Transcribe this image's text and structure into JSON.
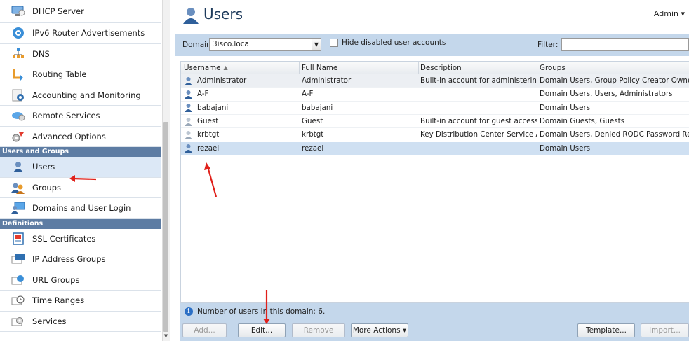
{
  "sidebar": {
    "items_top": [
      {
        "label": "DHCP Server",
        "icon": "dhcp-server-icon"
      },
      {
        "label": "IPv6 Router Advertisements",
        "icon": "ipv6-icon"
      },
      {
        "label": "DNS",
        "icon": "dns-icon"
      },
      {
        "label": "Routing Table",
        "icon": "routing-table-icon"
      },
      {
        "label": "Accounting and Monitoring",
        "icon": "accounting-icon"
      },
      {
        "label": "Remote Services",
        "icon": "remote-services-icon"
      },
      {
        "label": "Advanced Options",
        "icon": "advanced-options-icon"
      }
    ],
    "section_users": "Users and Groups",
    "items_users": [
      {
        "label": "Users",
        "icon": "users-icon"
      },
      {
        "label": "Groups",
        "icon": "groups-icon"
      },
      {
        "label": "Domains and User Login",
        "icon": "domains-icon"
      }
    ],
    "section_definitions": "Definitions",
    "items_definitions": [
      {
        "label": "SSL Certificates",
        "icon": "ssl-certificate-icon"
      },
      {
        "label": "IP Address Groups",
        "icon": "ip-address-groups-icon"
      },
      {
        "label": "URL Groups",
        "icon": "url-groups-icon"
      },
      {
        "label": "Time Ranges",
        "icon": "time-ranges-icon"
      },
      {
        "label": "Services",
        "icon": "services-icon"
      }
    ]
  },
  "header": {
    "title": "Users",
    "admin_menu": "Admin ▾"
  },
  "toolbar": {
    "domain_label": "Domain:",
    "domain_value": "3isco.local",
    "hide_disabled_label": "Hide disabled user accounts",
    "filter_label": "Filter:"
  },
  "grid": {
    "columns": [
      "Username",
      "Full Name",
      "Description",
      "Groups"
    ],
    "sort_indicator": "▲",
    "rows": [
      {
        "username": "Administrator",
        "full_name": "Administrator",
        "description": "Built-in account for administering...",
        "groups": "Domain Users, Group Policy Creator Owners...",
        "disabled": false
      },
      {
        "username": "A-F",
        "full_name": "A-F",
        "description": "",
        "groups": "Domain Users, Users, Administrators",
        "disabled": false
      },
      {
        "username": "babajani",
        "full_name": "babajani",
        "description": "",
        "groups": "Domain Users",
        "disabled": false
      },
      {
        "username": "Guest",
        "full_name": "Guest",
        "description": "Built-in account for guest access ...",
        "groups": "Domain Guests, Guests",
        "disabled": true
      },
      {
        "username": "krbtgt",
        "full_name": "krbtgt",
        "description": "Key Distribution Center Service A...",
        "groups": "Domain Users, Denied RODC Password Repl...",
        "disabled": true
      },
      {
        "username": "rezaei",
        "full_name": "rezaei",
        "description": "",
        "groups": "Domain Users",
        "disabled": false,
        "selected": true
      }
    ]
  },
  "status": {
    "text": "Number of users in this domain: 6."
  },
  "buttons": {
    "add": "Add...",
    "edit": "Edit...",
    "remove": "Remove",
    "more_actions": "More Actions ▾",
    "template": "Template...",
    "import": "Import..."
  },
  "colors": {
    "accent_bar": "#c4d7eb",
    "section_header": "#5d7ca3",
    "selected_row": "#cfe0f2",
    "annotation_arrow": "#e0201a"
  }
}
